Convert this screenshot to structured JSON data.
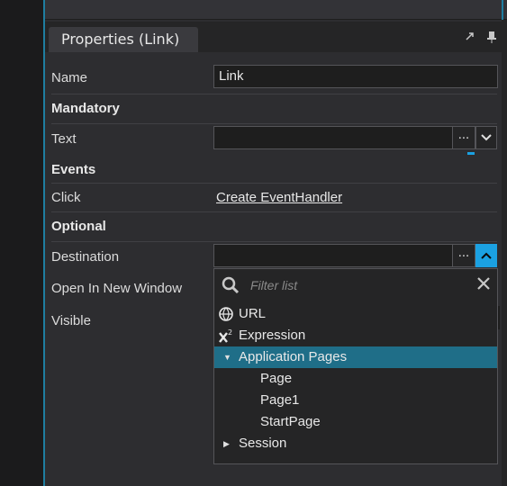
{
  "panel": {
    "tab_title": "Properties (Link)",
    "pin_icon": "pin-icon",
    "float_icon": "float-icon"
  },
  "properties": {
    "name_label": "Name",
    "name_value": "Link",
    "mandatory_section": "Mandatory",
    "text_label": "Text",
    "text_value": "",
    "events_section": "Events",
    "click_label": "Click",
    "click_link": "Create EventHandler",
    "optional_section": "Optional",
    "destination_label": "Destination",
    "destination_value": "",
    "open_new_window_label": "Open In New Window",
    "visible_label": "Visible",
    "ellipsis": "..."
  },
  "dropdown": {
    "filter_placeholder": "Filter list",
    "items": [
      {
        "label": "URL",
        "icon": "url-icon"
      },
      {
        "label": "Expression",
        "icon": "expression-icon"
      },
      {
        "label": "Application Pages",
        "expanded": true,
        "selected": true
      },
      {
        "label": "Page"
      },
      {
        "label": "Page1"
      },
      {
        "label": "StartPage"
      },
      {
        "label": "Session",
        "expanded": false
      }
    ]
  },
  "colors": {
    "accent": "#1ba1e2",
    "selection": "#1f6e88",
    "background": "#2d2d30"
  }
}
